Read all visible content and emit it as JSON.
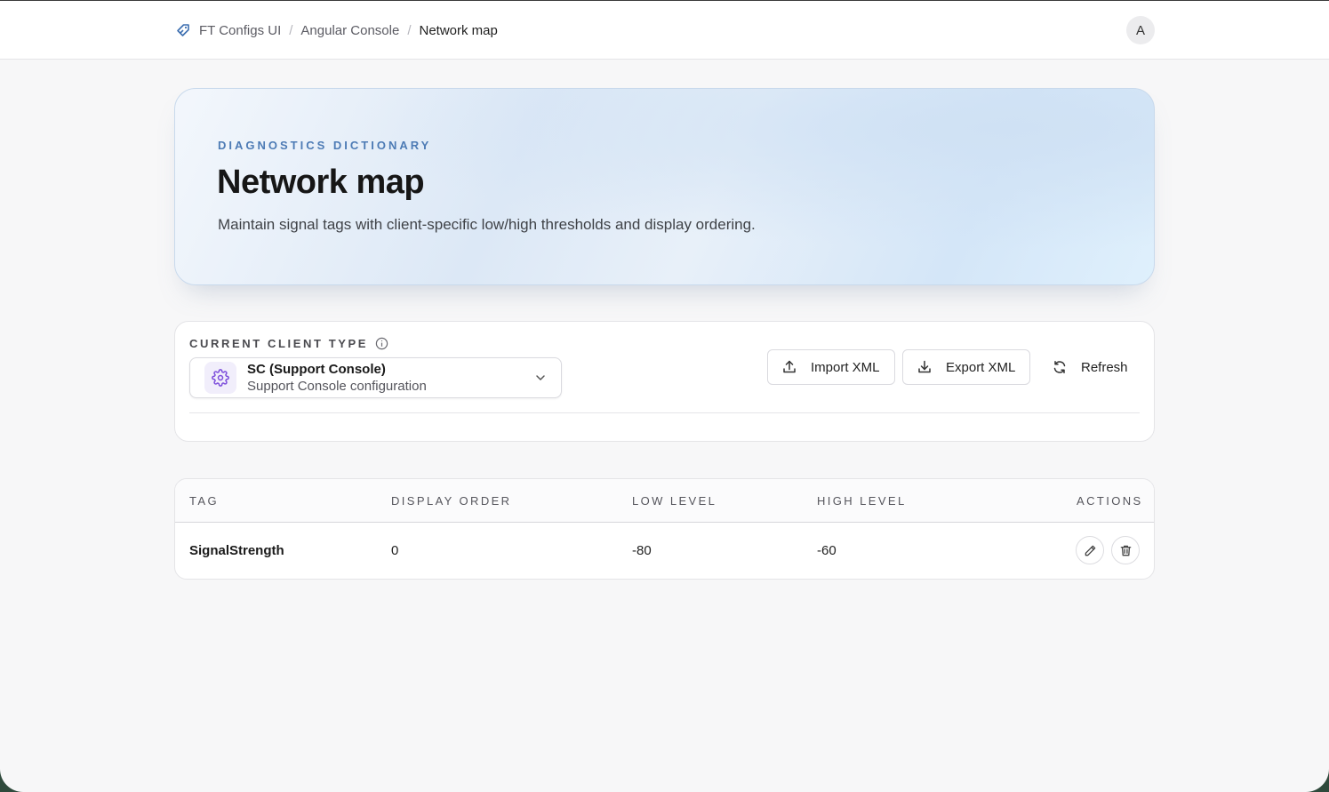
{
  "breadcrumb": {
    "items": [
      {
        "label": "FT Configs UI"
      },
      {
        "label": "Angular Console"
      },
      {
        "label": "Network map"
      }
    ],
    "separator": "/"
  },
  "user": {
    "avatar_initial": "A"
  },
  "hero": {
    "eyebrow": "DIAGNOSTICS DICTIONARY",
    "title": "Network map",
    "description": "Maintain signal tags with client-specific low/high thresholds and display ordering."
  },
  "client_panel": {
    "label": "CURRENT CLIENT TYPE",
    "selected": {
      "title": "SC (Support Console)",
      "subtitle": "Support Console configuration",
      "icon": "gear-icon"
    },
    "buttons": {
      "import": "Import XML",
      "export": "Export XML",
      "refresh": "Refresh"
    }
  },
  "table": {
    "columns": [
      "TAG",
      "DISPLAY ORDER",
      "LOW LEVEL",
      "HIGH LEVEL",
      "ACTIONS"
    ],
    "rows": [
      {
        "tag": "SignalStrength",
        "display_order": "0",
        "low_level": "-80",
        "high_level": "-60"
      }
    ]
  },
  "colors": {
    "accent": "#4d7bb5",
    "gear_accent": "#7c4ddb",
    "background": "#f7f7f8"
  }
}
